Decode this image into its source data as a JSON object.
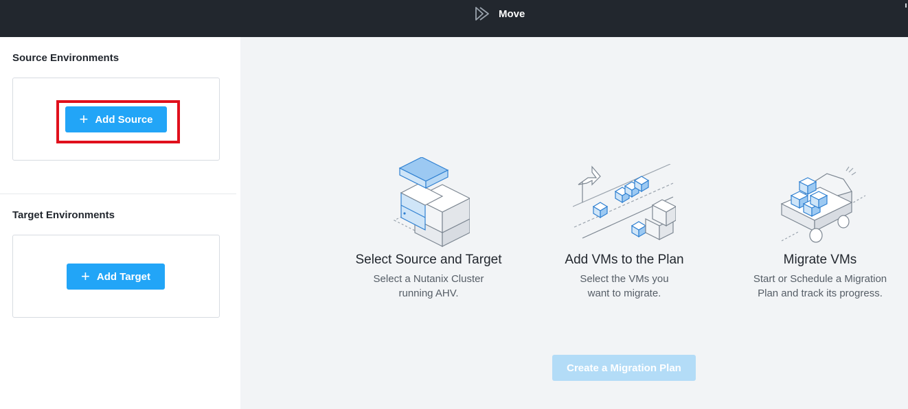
{
  "header": {
    "app_name": "Move",
    "logo_icon": "move-play-icon"
  },
  "sidebar": {
    "source": {
      "title": "Source Environments",
      "button_label": "Add Source"
    },
    "target": {
      "title": "Target Environments",
      "button_label": "Add Target"
    }
  },
  "main": {
    "steps": [
      {
        "icon": "source-target-cluster-illustration",
        "title": "Select Source and Target",
        "desc_line1": "Select a Nutanix Cluster",
        "desc_line2": "running AHV."
      },
      {
        "icon": "add-vms-conveyor-illustration",
        "title": "Add VMs to the Plan",
        "desc_line1": "Select the VMs you",
        "desc_line2": "want to migrate."
      },
      {
        "icon": "migrate-truck-illustration",
        "title": "Migrate VMs",
        "desc_line1": "Start or Schedule a Migration",
        "desc_line2": "Plan and track its progress."
      }
    ],
    "create_button_label": "Create a Migration Plan"
  },
  "colors": {
    "topbar": "#22272e",
    "primary": "#22a5f7",
    "disabled_primary": "#b3dcf7",
    "highlight": "#e0101c",
    "illustration_blue": "#2f80d1"
  }
}
